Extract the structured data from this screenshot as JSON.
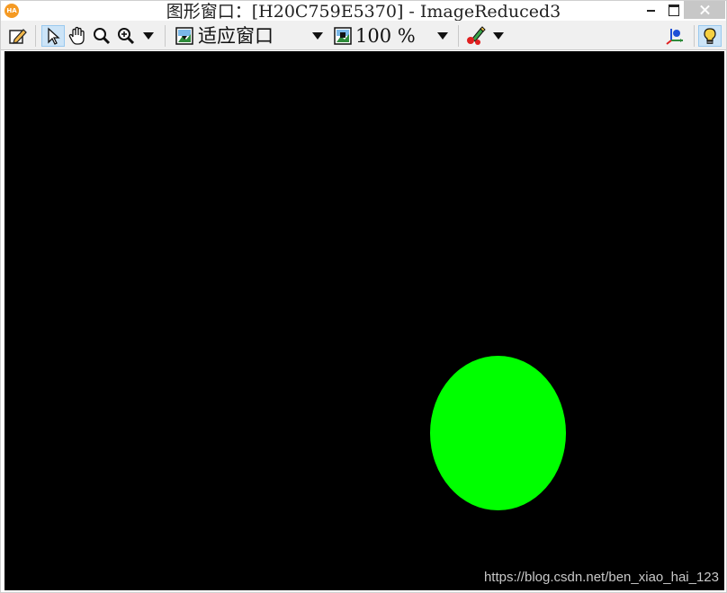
{
  "window": {
    "app_badge": "HA",
    "title": "图形窗口：[H20C759E5370] - ImageReduced3"
  },
  "toolbar": {
    "edit_icon": "pencil-edit-icon",
    "pointer_icon": "arrow-pointer-icon",
    "pan_icon": "hand-icon",
    "zoom_icon": "magnifier-icon",
    "zoom_in_icon": "magnifier-plus-icon",
    "fit_mode": "适应窗口",
    "zoom_level": "100 %",
    "color_icon": "color-draw-icon",
    "axes_icon": "axes-icon",
    "lightbulb_icon": "lightbulb-icon"
  },
  "canvas": {
    "background": "#000000",
    "shape_color": "#00ff00",
    "watermark": "https://blog.csdn.net/ben_xiao_hai_123"
  }
}
